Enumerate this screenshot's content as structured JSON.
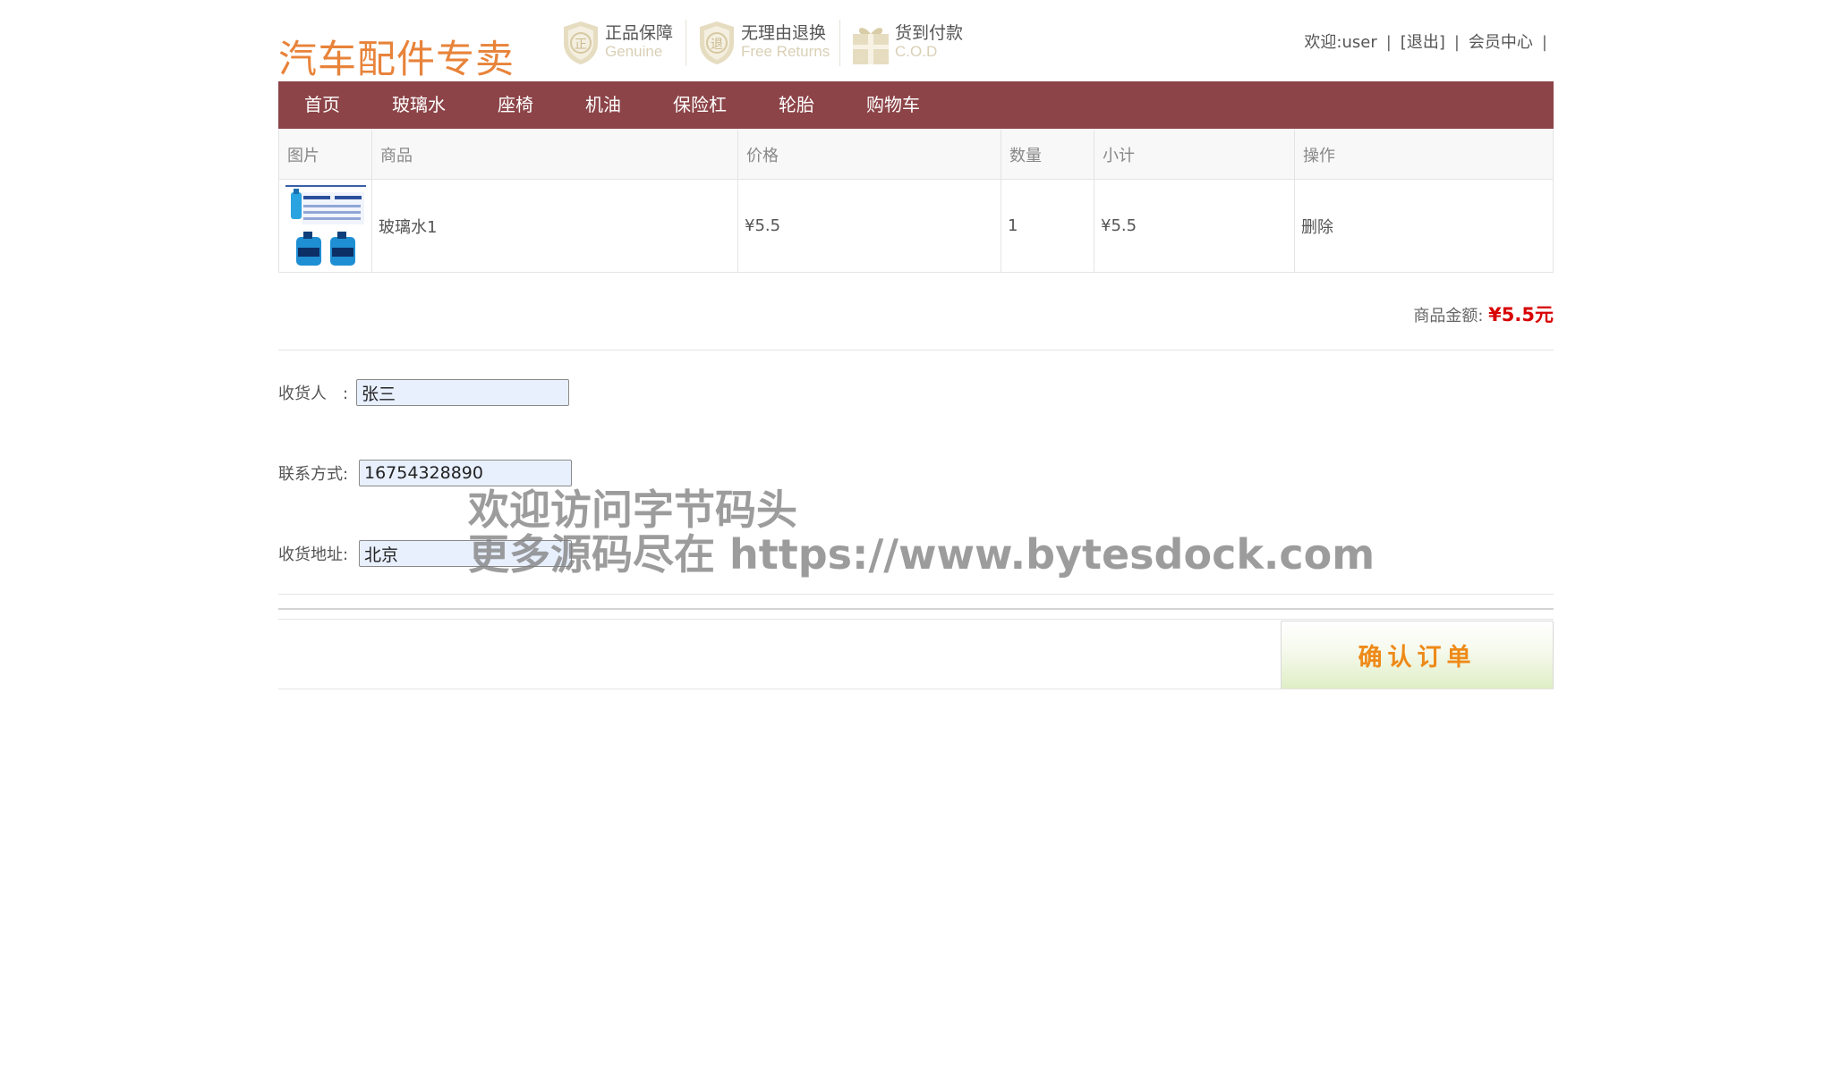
{
  "header": {
    "logo": "汽车配件专卖",
    "badges": [
      {
        "zh": "正品保障",
        "en": "Genuine",
        "glyph": "正"
      },
      {
        "zh": "无理由退换",
        "en": "Free Returns",
        "glyph": "退"
      },
      {
        "zh": "货到付款",
        "en": "C.O.D",
        "glyph": "gift"
      }
    ],
    "user": {
      "welcome": "欢迎:user",
      "logout": "[退出]",
      "member_center": "会员中心",
      "separator": "|"
    }
  },
  "nav": {
    "items": [
      "首页",
      "玻璃水",
      "座椅",
      "机油",
      "保险杠",
      "轮胎",
      "购物车"
    ]
  },
  "cart": {
    "headers": [
      "图片",
      "商品",
      "价格",
      "数量",
      "小计",
      "操作"
    ],
    "rows": [
      {
        "name": "玻璃水1",
        "price": "¥5.5",
        "qty": "1",
        "subtotal": "¥5.5",
        "action": "删除"
      }
    ],
    "total_label": "商品金额:",
    "total_value": "¥5.5元"
  },
  "form": {
    "receiver_label": "收货人　:",
    "receiver_value": "张三",
    "contact_label": "联系方式:",
    "contact_value": "16754328890",
    "address_label": "收货地址:",
    "address_value": "北京"
  },
  "confirm_label": "确认订单",
  "watermark": {
    "line1": "欢迎访问字节码头",
    "line2": "更多源码尽在  https://www.bytesdock.com"
  },
  "colors": {
    "nav_bg": "#8c4448",
    "logo": "#e8833a",
    "total_amount": "#d80000",
    "confirm_text": "#ee8a18"
  }
}
